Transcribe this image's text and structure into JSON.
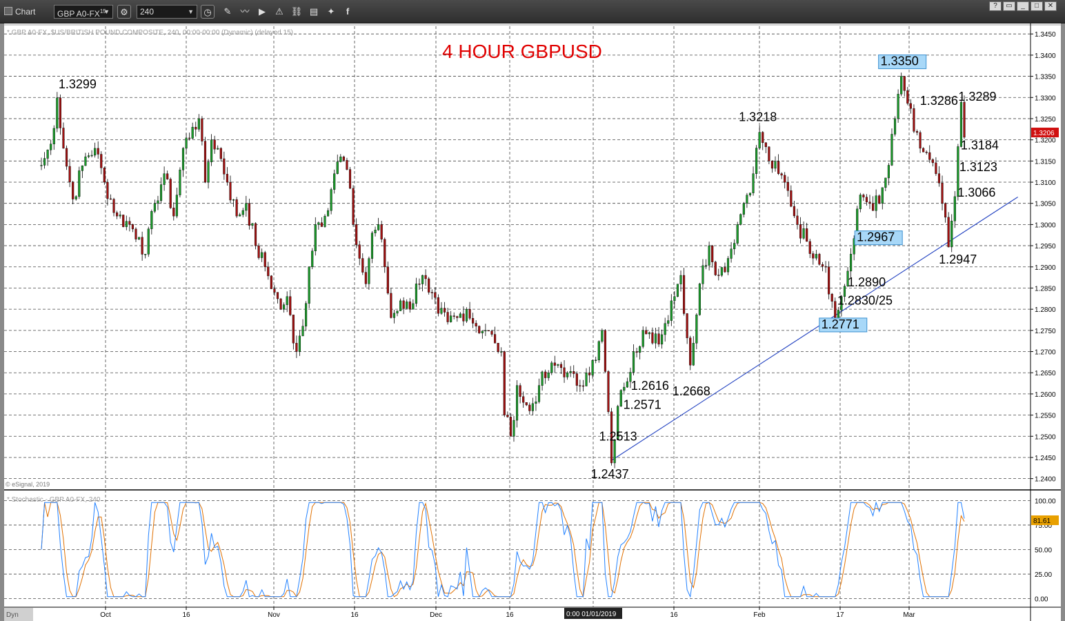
{
  "toolbar": {
    "title": "Chart",
    "symbol": "GBP A0-FX",
    "symbol_sup": "15",
    "interval": "240",
    "icons": [
      "settings-gear-icon",
      "clock-icon",
      "pencil-icon",
      "line-draw-icon",
      "play-icon",
      "alert-icon",
      "link-icon",
      "comment-icon",
      "twitter-icon",
      "facebook-icon"
    ],
    "window_buttons": [
      "?",
      "▭",
      "_",
      "□",
      "✕"
    ]
  },
  "main_chart": {
    "description": "* GBP A0-FX, $US/BRITISH POUND COMPOSITE, 240, 00:00-00:00 (Dynamic) (delayed 15)",
    "copyright": "© eSignal, 2019",
    "title": "4 HOUR GBPUSD",
    "title_color": "#e00000",
    "last_price": "1.3206",
    "last_price_color": "#d01010",
    "ticks": [
      "1.3450",
      "1.3400",
      "1.3350",
      "1.3300",
      "1.3250",
      "1.3200",
      "1.3150",
      "1.3100",
      "1.3050",
      "1.3000",
      "1.2950",
      "1.2900",
      "1.2850",
      "1.2800",
      "1.2750",
      "1.2700",
      "1.2650",
      "1.2600",
      "1.2550",
      "1.2500",
      "1.2450",
      "1.2400"
    ]
  },
  "stochastic": {
    "label": "* Stochastic - GBP A0-FX, 240",
    "value": "81.61",
    "value_color": "#e8a000",
    "ticks": [
      "100.00",
      "75.00",
      "50.00",
      "25.00",
      "0.00"
    ]
  },
  "x_axis": {
    "labels": [
      "Oct",
      "16",
      "Nov",
      "16",
      "Dec",
      "16",
      "01/01/2019",
      "16",
      "Feb",
      "17",
      "Mar"
    ],
    "cursor_label": "0:00 01/01/2019",
    "dyn_label": "Dyn"
  },
  "chart_data": {
    "type": "candlestick",
    "title": "4 HOUR GBPUSD",
    "ylim": [
      1.2375,
      1.3465
    ],
    "y_ticks": [
      1.345,
      1.34,
      1.335,
      1.33,
      1.325,
      1.32,
      1.315,
      1.31,
      1.305,
      1.3,
      1.295,
      1.29,
      1.285,
      1.28,
      1.275,
      1.27,
      1.265,
      1.26,
      1.255,
      1.25,
      1.245,
      1.24
    ],
    "x_labels": [
      "Oct",
      "16",
      "Nov",
      "16",
      "Dec",
      "16",
      "01/01/2019",
      "16",
      "Feb",
      "17",
      "Mar"
    ],
    "price_path": [
      [
        0,
        1.314
      ],
      [
        3,
        1.319
      ],
      [
        5,
        1.3299
      ],
      [
        7,
        1.318
      ],
      [
        10,
        1.306
      ],
      [
        14,
        1.316
      ],
      [
        17,
        1.318
      ],
      [
        20,
        1.31
      ],
      [
        24,
        1.302
      ],
      [
        28,
        1.3
      ],
      [
        31,
        1.297
      ],
      [
        33,
        1.293
      ],
      [
        36,
        1.305
      ],
      [
        39,
        1.312
      ],
      [
        42,
        1.302
      ],
      [
        45,
        1.318
      ],
      [
        48,
        1.323
      ],
      [
        50,
        1.325
      ],
      [
        52,
        1.31
      ],
      [
        54,
        1.32
      ],
      [
        56,
        1.318
      ],
      [
        59,
        1.31
      ],
      [
        62,
        1.302
      ],
      [
        65,
        1.305
      ],
      [
        68,
        1.295
      ],
      [
        71,
        1.29
      ],
      [
        74,
        1.284
      ],
      [
        76,
        1.28
      ],
      [
        78,
        1.283
      ],
      [
        80,
        1.272
      ],
      [
        81,
        1.27
      ],
      [
        83,
        1.276
      ],
      [
        85,
        1.29
      ],
      [
        87,
        1.3
      ],
      [
        90,
        1.302
      ],
      [
        93,
        1.312
      ],
      [
        95,
        1.316
      ],
      [
        97,
        1.313
      ],
      [
        99,
        1.3
      ],
      [
        101,
        1.292
      ],
      [
        103,
        1.286
      ],
      [
        105,
        1.298
      ],
      [
        107,
        1.3
      ],
      [
        109,
        1.29
      ],
      [
        111,
        1.278
      ],
      [
        114,
        1.282
      ],
      [
        117,
        1.28
      ],
      [
        119,
        1.286
      ],
      [
        121,
        1.288
      ],
      [
        123,
        1.284
      ],
      [
        126,
        1.279
      ],
      [
        129,
        1.277
      ],
      [
        132,
        1.278
      ],
      [
        135,
        1.28
      ],
      [
        138,
        1.276
      ],
      [
        141,
        1.275
      ],
      [
        144,
        1.272
      ],
      [
        146,
        1.27
      ],
      [
        147,
        1.255
      ],
      [
        149,
        1.25
      ],
      [
        151,
        1.262
      ],
      [
        153,
        1.258
      ],
      [
        155,
        1.256
      ],
      [
        158,
        1.262
      ],
      [
        161,
        1.265
      ],
      [
        164,
        1.267
      ],
      [
        167,
        1.265
      ],
      [
        170,
        1.262
      ],
      [
        173,
        1.265
      ],
      [
        176,
        1.268
      ],
      [
        178,
        1.275
      ],
      [
        181,
        1.2437
      ],
      [
        183,
        1.2571
      ],
      [
        185,
        1.2616
      ],
      [
        188,
        1.27
      ],
      [
        191,
        1.275
      ],
      [
        194,
        1.272
      ],
      [
        197,
        1.274
      ],
      [
        200,
        1.282
      ],
      [
        203,
        1.288
      ],
      [
        206,
        1.2668
      ],
      [
        209,
        1.286
      ],
      [
        212,
        1.295
      ],
      [
        215,
        1.288
      ],
      [
        218,
        1.292
      ],
      [
        221,
        1.3
      ],
      [
        223,
        1.305
      ],
      [
        226,
        1.312
      ],
      [
        228,
        1.3218
      ],
      [
        231,
        1.315
      ],
      [
        234,
        1.312
      ],
      [
        237,
        1.308
      ],
      [
        240,
        1.3
      ],
      [
        243,
        1.296
      ],
      [
        246,
        1.293
      ],
      [
        249,
        1.29
      ],
      [
        252,
        1.2771
      ],
      [
        254,
        1.283
      ],
      [
        256,
        1.289
      ],
      [
        258,
        1.2967
      ],
      [
        260,
        1.307
      ],
      [
        263,
        1.305
      ],
      [
        266,
        1.305
      ],
      [
        269,
        1.314
      ],
      [
        271,
        1.325
      ],
      [
        273,
        1.335
      ],
      [
        275,
        1.3286
      ],
      [
        277,
        1.322
      ],
      [
        279,
        1.318
      ],
      [
        281,
        1.317
      ],
      [
        284,
        1.312
      ],
      [
        286,
        1.305
      ],
      [
        288,
        1.2947
      ],
      [
        290,
        1.3066
      ],
      [
        291,
        1.3184
      ],
      [
        292,
        1.3289
      ],
      [
        293,
        1.3206
      ]
    ],
    "bar_count": 294,
    "annotations": [
      {
        "text": "1.3299",
        "x": 5,
        "y": 1.3299,
        "box": false
      },
      {
        "text": "1.3218",
        "x": 228,
        "y": 1.3218,
        "box": false
      },
      {
        "text": "1.3350",
        "x": 273,
        "y": 1.335,
        "box": true
      },
      {
        "text": "1.3286",
        "x": 275,
        "y": 1.3286,
        "box": false
      },
      {
        "text": "1.3289",
        "x": 292,
        "y": 1.3289,
        "box": false
      },
      {
        "text": "1.3184",
        "x": 291,
        "y": 1.3184,
        "box": false
      },
      {
        "text": "1.3123",
        "x": 291,
        "y": 1.3123,
        "box": false
      },
      {
        "text": "1.3066",
        "x": 290,
        "y": 1.3066,
        "box": false
      },
      {
        "text": "1.2947",
        "x": 288,
        "y": 1.2947,
        "box": false
      },
      {
        "text": "1.2967",
        "x": 258,
        "y": 1.2967,
        "box": true
      },
      {
        "text": "1.2890",
        "x": 256,
        "y": 1.289,
        "box": false
      },
      {
        "text": "1.2830/25",
        "x": 254,
        "y": 1.283,
        "box": false
      },
      {
        "text": "1.2771",
        "x": 252,
        "y": 1.2771,
        "box": true
      },
      {
        "text": "1.2668",
        "x": 206,
        "y": 1.2668,
        "box": false
      },
      {
        "text": "1.2616",
        "x": 185,
        "y": 1.2616,
        "box": false
      },
      {
        "text": "1.2571",
        "x": 183,
        "y": 1.2571,
        "box": false
      },
      {
        "text": "1.2513",
        "x": 181,
        "y": 1.2513,
        "box": false
      },
      {
        "text": "1.2437",
        "x": 181,
        "y": 1.2437,
        "box": false
      }
    ],
    "trendline": [
      [
        181,
        1.2443
      ],
      [
        310,
        1.3065
      ]
    ],
    "stochastic": {
      "ylim": [
        -8,
        108
      ],
      "levels": [
        25,
        75
      ],
      "current": 81.61
    }
  }
}
